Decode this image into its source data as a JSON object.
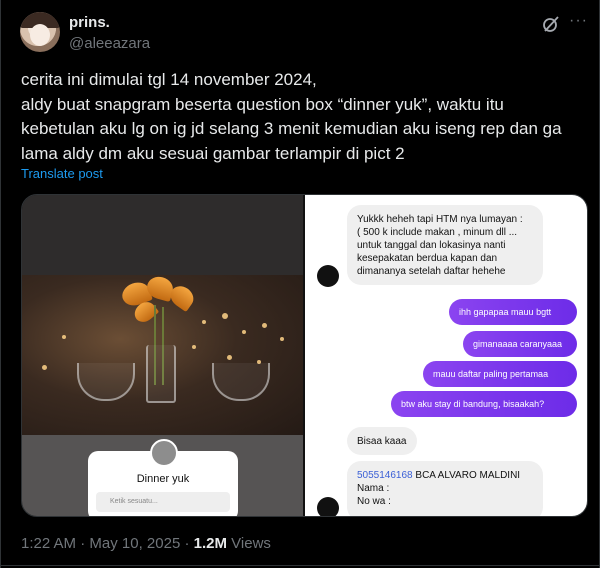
{
  "author": {
    "name": "prins.",
    "handle": "@aleeazara"
  },
  "header_icons": {
    "grok": "grok-icon",
    "more": "more-icon",
    "more_glyph": "···"
  },
  "tweet": {
    "lines": [
      "cerita ini dimulai tgl 14 november 2024,",
      "aldy buat snapgram beserta question box “dinner yuk”, waktu itu",
      "kebetulan aku lg on ig jd selang 3 menit kemudian aku iseng rep dan ga",
      "lama aldy dm aku sesuai gambar terlampir di pict 2"
    ],
    "translate_label": "Translate post"
  },
  "media": {
    "image1": {
      "story_question": "Dinner yuk",
      "story_input_placeholder": "Ketik sesuatu..."
    },
    "image2": {
      "messages_in_1": [
        "Yukkk heheh tapi HTM nya lumayan :",
        "( 500 k include makan , minum dll ...",
        "untuk tanggal dan lokasinya nanti",
        "kesepakatan berdua kapan dan",
        "dimananya setelah daftar hehehe"
      ],
      "messages_out": [
        "ihh gapapaa mauu bgtt",
        "gimanaaaa caranyaaa",
        "mauu daftar paling pertamaa",
        "btw aku stay di bandung, bisaakah?"
      ],
      "reply_short": "Bisaa kaaa",
      "payment": {
        "account_number": "5055146168",
        "account_name": "BCA ALVARO MALDINI",
        "field_1": "Nama :",
        "field_2": "No wa :"
      }
    }
  },
  "meta": {
    "time": "1:22 AM",
    "date": "May 10, 2025",
    "views_count": "1.2M",
    "views_label": "Views",
    "separator": "·"
  },
  "colors": {
    "link": "#1d9bf0",
    "muted": "#71767b",
    "text": "#e7e9ea",
    "dm_purple": "#7c3aed"
  }
}
